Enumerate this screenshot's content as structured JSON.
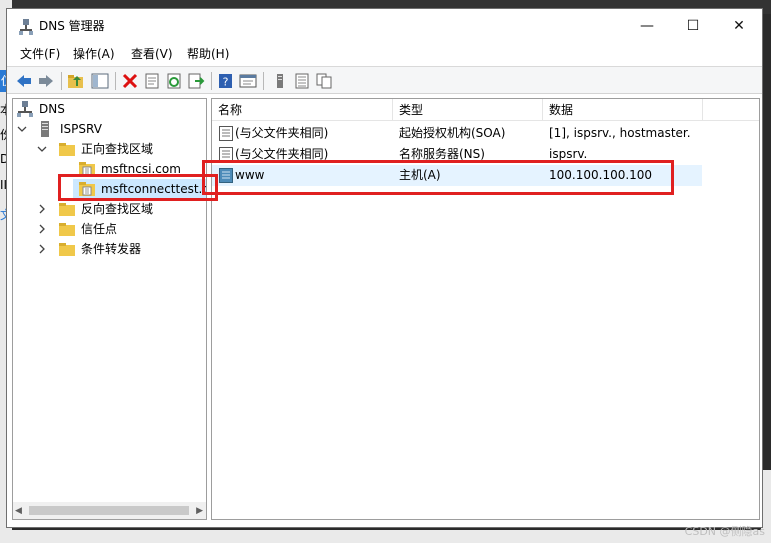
{
  "window": {
    "title": "DNS 管理器",
    "minimize_glyph": "—",
    "maximize_glyph": "☐",
    "close_glyph": "✕"
  },
  "background": {
    "left_fragments": [
      "仪",
      "本",
      "份",
      "D",
      "IIS",
      "文"
    ],
    "watermark": "CSDN @侧隐as"
  },
  "menu": {
    "file": "文件(F)",
    "action": "操作(A)",
    "view": "查看(V)",
    "help": "帮助(H)"
  },
  "toolbar": {
    "icons": [
      "back-icon",
      "forward-icon",
      "up-folder-icon",
      "show-tree-icon",
      "delete-icon",
      "properties-icon",
      "refresh-icon",
      "export-icon",
      "help-icon",
      "console-icon",
      "server-icon",
      "list-icon",
      "copy-icon"
    ]
  },
  "tree": {
    "root": "DNS",
    "server": "ISPSRV",
    "forward_zones": "正向查找区域",
    "zone1": "msftncsi.com",
    "zone2": "msftconnecttest.co",
    "reverse_zones": "反向查找区域",
    "trust_points": "信任点",
    "conditional_forwarders": "条件转发器"
  },
  "list": {
    "columns": [
      "名称",
      "类型",
      "数据"
    ],
    "rows": [
      {
        "name": "(与父文件夹相同)",
        "type": "起始授权机构(SOA)",
        "data": "[1], ispsrv., hostmaster."
      },
      {
        "name": "(与父文件夹相同)",
        "type": "名称服务器(NS)",
        "data": "ispsrv."
      },
      {
        "name": "www",
        "type": "主机(A)",
        "data": "100.100.100.100"
      }
    ]
  },
  "colors": {
    "highlight_red": "#e02020",
    "selected_row": "#e5f3ff",
    "selected_tree": "#cce8ff"
  }
}
